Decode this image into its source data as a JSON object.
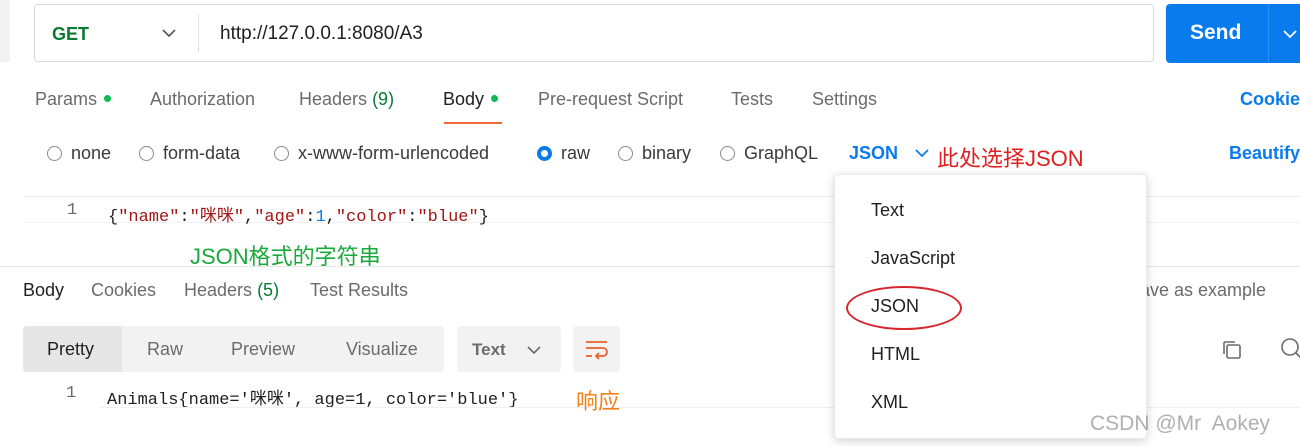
{
  "request": {
    "method": "GET",
    "url": "http://127.0.0.1:8080/A3",
    "send_label": "Send"
  },
  "request_tabs": [
    {
      "label": "Params",
      "dot": true
    },
    {
      "label": "Authorization"
    },
    {
      "label": "Headers",
      "count": "(9)"
    },
    {
      "label": "Body",
      "dot": true,
      "active": true
    },
    {
      "label": "Pre-request Script"
    },
    {
      "label": "Tests"
    },
    {
      "label": "Settings"
    }
  ],
  "cookies_link": "Cookie",
  "body_types": [
    {
      "label": "none"
    },
    {
      "label": "form-data"
    },
    {
      "label": "x-www-form-urlencoded"
    },
    {
      "label": "raw",
      "selected": true
    },
    {
      "label": "binary"
    },
    {
      "label": "GraphQL"
    }
  ],
  "raw_format": "JSON",
  "beautify_label": "Beautify",
  "annotations": {
    "select_json": "此处选择JSON",
    "json_string": "JSON格式的字符串",
    "response": "响应"
  },
  "editor": {
    "line_number": "1",
    "code_parts": [
      "{",
      "\"name\"",
      ":",
      "\"咪咪\"",
      ",",
      "\"age\"",
      ":",
      "1",
      ",",
      "\"color\"",
      ":",
      "\"blue\"",
      "}"
    ]
  },
  "response_tabs": [
    {
      "label": "Body",
      "active": true
    },
    {
      "label": "Cookies"
    },
    {
      "label": "Headers",
      "count": "(5)"
    },
    {
      "label": "Test Results"
    }
  ],
  "save_example": "ave as example",
  "view_modes": [
    {
      "label": "Pretty",
      "active": true
    },
    {
      "label": "Raw"
    },
    {
      "label": "Preview"
    },
    {
      "label": "Visualize"
    }
  ],
  "response_format": "Text",
  "response_body": {
    "line_number": "1",
    "text": "Animals{name='咪咪', age=1, color='blue'}"
  },
  "dropdown_options": [
    "Text",
    "JavaScript",
    "JSON",
    "HTML",
    "XML"
  ],
  "watermark": "CSDN @Mr  Aokey",
  "colors": {
    "accent_blue": "#097bed",
    "method_green": "#0a7b32",
    "active_tab_underline": "#f26b3a",
    "annotation_red": "#e02020",
    "annotation_green": "#1aaa3b",
    "annotation_orange": "#f0821e"
  }
}
